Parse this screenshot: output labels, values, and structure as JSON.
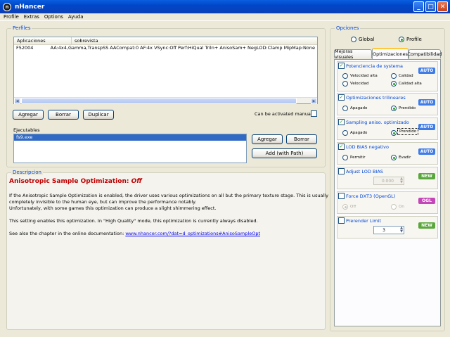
{
  "window": {
    "title": "nHancer",
    "app_icon_letter": "n"
  },
  "menu": [
    "Profile",
    "Extras",
    "Options",
    "Ayuda"
  ],
  "profiles": {
    "title": "Perfiles",
    "columns": [
      "Aplicaciones",
      "sobrevista"
    ],
    "rows": [
      {
        "app": "F52004",
        "overview": "AA:4x4,Gamma,TranspSS AACompat:0 AF:4x VSync:Off Perf:HiQual Triln+ AnisoSam+ NegLOD:Clamp MipMap:None"
      }
    ],
    "buttons": {
      "add": "Agregar",
      "delete": "Borrar",
      "duplicate": "Duplicar"
    },
    "manual_label": "Can be activated manually"
  },
  "executables": {
    "title": "Ejecutables",
    "items": [
      "fs9.exe"
    ],
    "buttons": {
      "add": "Agregar",
      "delete": "Borrar",
      "add_path": "Add (with Path)"
    }
  },
  "description": {
    "title": "Descripcion",
    "heading": "Anisotropic Sample Optimization:",
    "heading_state": "Off",
    "para1_l1": "If the Anisotropic Sample Optimization is enabled, the driver uses various optimizations on all but the primary texture stage. This is usually",
    "para1_l2": "completely invisible to the human eye, but can improve the performance notably.",
    "para1_l3": "Unfortunately, with some games this optimization can produce a slight shimmering effect.",
    "para2": "This setting enables this optimization. In \"High Quality\" mode, this optimization is currently always disabled.",
    "para3": "See also the chapter in the online documentation:",
    "link": "www.nhancer.com/?dat=d_optimizations#AnisoSampleOpt"
  },
  "options": {
    "title": "Opciones",
    "scope": {
      "global": "Global",
      "profile": "Profile",
      "selected": "profile"
    },
    "tabs": [
      "Mejoras visuales",
      "Optimizaciones",
      "Compatibilidad"
    ],
    "active_tab": "Optimizaciones",
    "badge_colors": {
      "auto": "#3F7CE8",
      "new": "#5AA83D",
      "ogl": "#C446B8"
    },
    "sections": [
      {
        "label": "Potenciencia de systema",
        "checked": true,
        "badge": "AUTO",
        "options": [
          "Velocidad alta",
          "Calidad",
          "Velocidad",
          "Calidad alta"
        ],
        "selected": "Calidad alta"
      },
      {
        "label": "Optimizaciones trilineares",
        "checked": true,
        "badge": "AUTO",
        "options": [
          "Apagado",
          "Prendido"
        ],
        "selected": "Prendido"
      },
      {
        "label": "Sampling aniso. optimizado",
        "checked": true,
        "badge": "AUTO",
        "options": [
          "Apagado",
          "Prendido"
        ],
        "selected": "Prendido"
      },
      {
        "label": "LOD BIAS negativo",
        "checked": true,
        "badge": "AUTO",
        "options": [
          "Permitir",
          "Evadir"
        ],
        "selected": "Evadir"
      },
      {
        "label": "Adjust LOD BIAS",
        "checked": false,
        "badge": "NEW",
        "value": "0.000"
      },
      {
        "label": "Force DXT3 (OpenGL)",
        "checked": false,
        "badge": "OGL",
        "options": [
          "Off",
          "On"
        ],
        "selected": "Off"
      },
      {
        "label": "Prerender Limit",
        "checked": false,
        "badge": "NEW",
        "value": "3"
      }
    ]
  }
}
